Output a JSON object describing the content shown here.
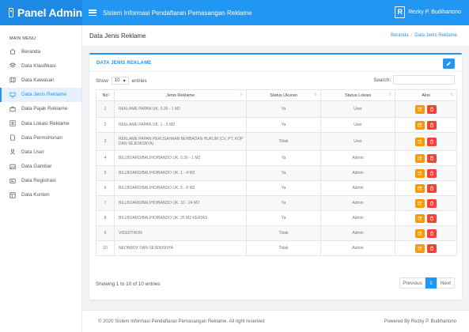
{
  "header": {
    "brand": "Panel Admin",
    "app_title": "Sistem Informasi Pendaftaran Pemasangan Reklame",
    "user_logo_letter": "R",
    "user_name": "Rezky P. Budihartono"
  },
  "sidebar": {
    "menu_title": "MAIN MENU",
    "items": [
      {
        "label": "Beranda",
        "icon": "home-icon"
      },
      {
        "label": "Data Klasifikasi",
        "icon": "layers-icon"
      },
      {
        "label": "Data Kawasan",
        "icon": "map-icon"
      },
      {
        "label": "Data Jenis Reklame",
        "icon": "monitor-icon",
        "active": true
      },
      {
        "label": "Data Pajak Reklame",
        "icon": "briefcase-icon"
      },
      {
        "label": "Data Lokasi Reklame",
        "icon": "location-icon"
      },
      {
        "label": "Data Permohonan",
        "icon": "file-icon"
      },
      {
        "label": "Data User",
        "icon": "user-icon"
      },
      {
        "label": "Data Gambar",
        "icon": "image-icon"
      },
      {
        "label": "Data Registrasi",
        "icon": "id-card-icon"
      },
      {
        "label": "Data Konten",
        "icon": "layout-icon"
      }
    ]
  },
  "page": {
    "title": "Data Jenis Reklame",
    "breadcrumb_home": "Beranda",
    "breadcrumb_sep": "/",
    "breadcrumb_current": "Data Jenis Reklame"
  },
  "card": {
    "title": "DATA JENIS REKLAME",
    "show_label": "Show",
    "show_value": "10",
    "entries_label": "entries",
    "search_label": "Search:",
    "search_value": ""
  },
  "table": {
    "columns": [
      "No",
      "Jenis Reklame",
      "Status Ukuran",
      "Status Lokasi",
      "Aksi"
    ],
    "rows": [
      {
        "no": "1",
        "jenis": "REKLAME PAPAN UK. 0.26 - 1 M2",
        "ukuran": "Ya",
        "lokasi": "User"
      },
      {
        "no": "2",
        "jenis": "REKLAME PAPAN UK. 1 - 5 M2",
        "ukuran": "Ya",
        "lokasi": "User"
      },
      {
        "no": "3",
        "jenis": "REKLAME PAPAN PERUSAHAAN BERBADAN HUKUM (CV, PT, KOP DAN SEJENISNYA)",
        "ukuran": "Tidak",
        "lokasi": "User"
      },
      {
        "no": "4",
        "jenis": "BILLBOARD/BALIHO/BANDO UK. 0.26 - 1 M2",
        "ukuran": "Ya",
        "lokasi": "Admin"
      },
      {
        "no": "5",
        "jenis": "BILLBOARD/BALIHO/BANDO UK. 1 - 4 M2",
        "ukuran": "Ya",
        "lokasi": "Admin"
      },
      {
        "no": "6",
        "jenis": "BILLBOARD/BALIHO/BANDO UK. 5 - 8 M2",
        "ukuran": "Ya",
        "lokasi": "Admin"
      },
      {
        "no": "7",
        "jenis": "BILLBOARD/BALIHO/BANDO UK. 10 - 24 M2",
        "ukuran": "Ya",
        "lokasi": "Admin"
      },
      {
        "no": "8",
        "jenis": "BILLBOARD/BALIHO/BANDO UK. 25 M2 KEATAS",
        "ukuran": "Ya",
        "lokasi": "Admin"
      },
      {
        "no": "9",
        "jenis": "VIDEOTRON",
        "ukuran": "Tidak",
        "lokasi": "Admin"
      },
      {
        "no": "10",
        "jenis": "NEONBOX DAN SEJENISNYA",
        "ukuran": "Tidak",
        "lokasi": "Admin"
      }
    ]
  },
  "pagination": {
    "info": "Showing 1 to 10 of 10 entries",
    "prev": "Previous",
    "current": "1",
    "next": "Next"
  },
  "footer": {
    "left": "© 2020 Sistem Informasi Pendaftaran Pemasangan Reklame. All right reserved",
    "right": "Powered By Rezky P. Budihartono"
  },
  "colors": {
    "primary": "#2196f3",
    "edit": "#ff9800",
    "delete": "#f44336"
  }
}
